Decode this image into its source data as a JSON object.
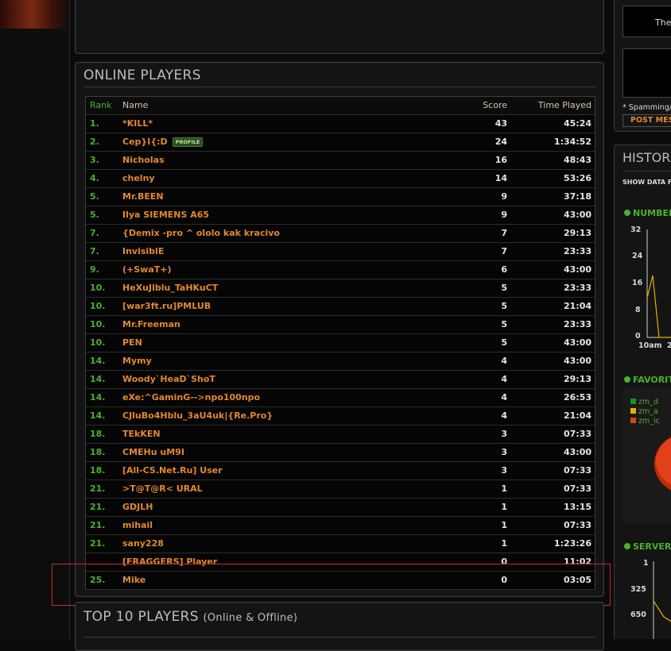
{
  "online_players": {
    "title": "ONLINE PLAYERS",
    "columns": {
      "rank": "Rank",
      "name": "Name",
      "score": "Score",
      "time": "Time Played"
    },
    "profile_badge": "PROFILE",
    "rows": [
      {
        "rank": "1.",
        "name": "*KILL*",
        "score": "43",
        "time": "45:24"
      },
      {
        "rank": "2.",
        "name": "Cep}I{:D",
        "score": "24",
        "time": "1:34:52"
      },
      {
        "rank": "3.",
        "name": "Nicholas",
        "score": "16",
        "time": "48:43"
      },
      {
        "rank": "4.",
        "name": "chelny",
        "score": "14",
        "time": "53:26"
      },
      {
        "rank": "5.",
        "name": "Mr.BEEN",
        "score": "9",
        "time": "37:18"
      },
      {
        "rank": "5.",
        "name": "Ilya SIEMENS A65",
        "score": "9",
        "time": "43:00"
      },
      {
        "rank": "7.",
        "name": "{Demix -pro ^ ololo kak kracivo",
        "score": "7",
        "time": "29:13"
      },
      {
        "rank": "7.",
        "name": "InvisiblE",
        "score": "7",
        "time": "23:33"
      },
      {
        "rank": "9.",
        "name": "(+SwaT+)",
        "score": "6",
        "time": "43:00"
      },
      {
        "rank": "10.",
        "name": "HeXuJlblu_TaHKuCT",
        "score": "5",
        "time": "23:33"
      },
      {
        "rank": "10.",
        "name": "[war3ft.ru]PMLUB",
        "score": "5",
        "time": "21:04"
      },
      {
        "rank": "10.",
        "name": "Mr.Freeman",
        "score": "5",
        "time": "23:33"
      },
      {
        "rank": "10.",
        "name": "PEN",
        "score": "5",
        "time": "43:00"
      },
      {
        "rank": "14.",
        "name": "Mymy",
        "score": "4",
        "time": "43:00"
      },
      {
        "rank": "14.",
        "name": "Woody`HeaD`ShoT",
        "score": "4",
        "time": "29:13"
      },
      {
        "rank": "14.",
        "name": "eXe:^GaminG-->npo100npo",
        "score": "4",
        "time": "26:53"
      },
      {
        "rank": "14.",
        "name": "CJluBo4Hblu_3aU4uk|{Re.Pro}",
        "score": "4",
        "time": "21:04"
      },
      {
        "rank": "18.",
        "name": "TEkKEN",
        "score": "3",
        "time": "07:33"
      },
      {
        "rank": "18.",
        "name": "CMEHu uM9I",
        "score": "3",
        "time": "43:00"
      },
      {
        "rank": "18.",
        "name": "[All-CS.Net.Ru] User",
        "score": "3",
        "time": "07:33"
      },
      {
        "rank": "21.",
        "name": ">T@T@R< URAL",
        "score": "1",
        "time": "07:33"
      },
      {
        "rank": "21.",
        "name": "GDJLH",
        "score": "1",
        "time": "13:15"
      },
      {
        "rank": "21.",
        "name": "mihail",
        "score": "1",
        "time": "07:33"
      },
      {
        "rank": "21.",
        "name": "sany228",
        "score": "1",
        "time": "1:23:26"
      },
      {
        "rank": "",
        "name": "[FRAGGERS] Player",
        "score": "0",
        "time": "11:02"
      },
      {
        "rank": "25.",
        "name": "Mike",
        "score": "0",
        "time": "03:05"
      }
    ]
  },
  "top10": {
    "title": "TOP 10 PLAYERS",
    "subtitle": "(Online & Offline)"
  },
  "sidebar": {
    "message_preview": "Ther",
    "spam_note": "* Spamming/",
    "post_button": "POST MES",
    "history_title": "HISTOR",
    "show_data": "SHOW DATA FOR",
    "section_number": "NUMBER",
    "chart1_y_ticks": [
      "32",
      "24",
      "16",
      "8",
      "0"
    ],
    "chart1_x_ticks": [
      "10am",
      "2"
    ],
    "section_favorite": "FAVORIT",
    "legend": [
      {
        "label": "zm_d",
        "color": "#1f8f1f"
      },
      {
        "label": "zm_a",
        "color": "#e8b000"
      },
      {
        "label": "zm_ic",
        "color": "#d04a10"
      }
    ],
    "section_server": "SERVER",
    "chart3_y_ticks": [
      "1",
      "325",
      "650"
    ]
  }
}
